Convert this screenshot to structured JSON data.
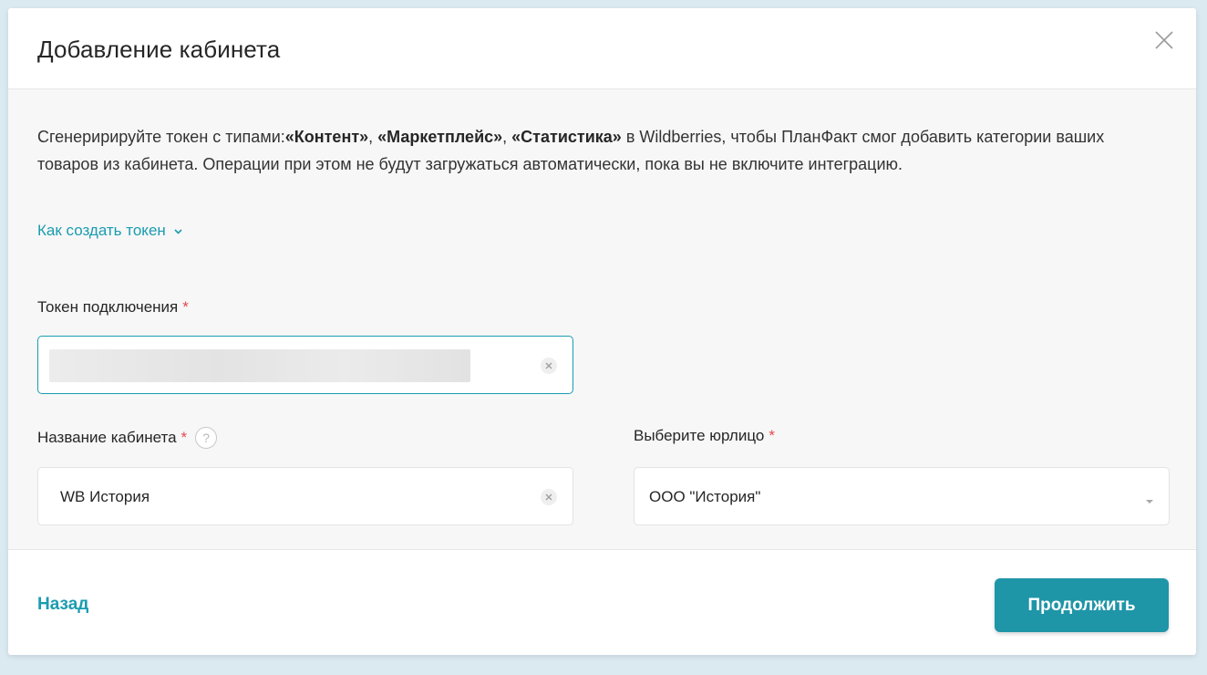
{
  "dialog": {
    "title": "Добавление кабинета"
  },
  "intro": {
    "part1": "Сгенеририруйте токен с типами:",
    "type1": "«Контент»",
    "sep1": ", ",
    "type2": "«Маркетплейс»",
    "sep2": ", ",
    "type3": "«Статистика»",
    "part2": " в Wildberries, чтобы ПланФакт смог добавить категории ваших товаров из кабинета. Операции при этом не будут загружаться автоматически, пока вы не включите интеграцию."
  },
  "howto": {
    "label": "Как создать токен"
  },
  "token_field": {
    "label": "Токен подключения",
    "required_mark": "*",
    "value": ""
  },
  "cabinet_name_field": {
    "label": "Название кабинета",
    "required_mark": "*",
    "help": "?",
    "value": "WB История"
  },
  "legal_entity_field": {
    "label": "Выберите юрлицо",
    "required_mark": "*",
    "selected": "ООО \"История\""
  },
  "footer": {
    "back_label": "Назад",
    "continue_label": "Продолжить"
  },
  "colors": {
    "accent": "#1a9cb0",
    "button": "#1f95a8",
    "required": "#e5484d",
    "body_bg": "#f7f7f7"
  },
  "icons": {
    "close": "close-icon",
    "chevron": "chevron-down-icon",
    "clear": "clear-icon",
    "help": "help-icon",
    "caret": "caret-down-icon"
  }
}
